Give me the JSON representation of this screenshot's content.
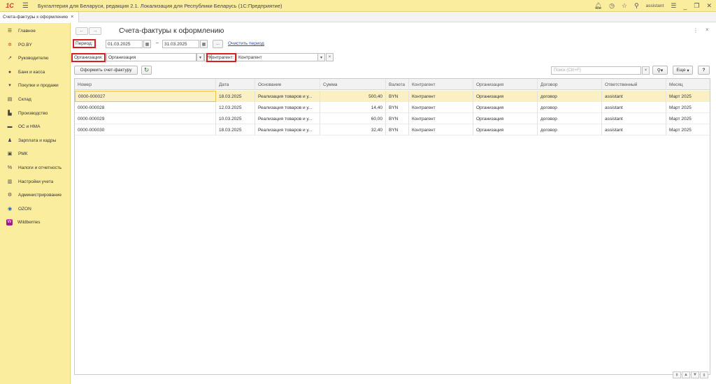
{
  "window": {
    "app_title": "Бухгалтерия для Беларуси, редакция 2.1. Локализация для Республики Беларусь  (1С:Предприятие)",
    "logo": "1С",
    "user": "assistant"
  },
  "tabs": [
    {
      "label": "Счета-фактуры к оформлению",
      "close": "×"
    }
  ],
  "sidebar": {
    "items": [
      {
        "label": "Главное",
        "icon": "menu-icon"
      },
      {
        "label": "PO.BY",
        "icon": "star-icon"
      },
      {
        "label": "Руководителю",
        "icon": "trend-icon"
      },
      {
        "label": "Банк и касса",
        "icon": "bank-icon"
      },
      {
        "label": "Покупки и продажи",
        "icon": "cart-icon"
      },
      {
        "label": "Склад",
        "icon": "warehouse-icon"
      },
      {
        "label": "Производство",
        "icon": "factory-icon"
      },
      {
        "label": "ОС и НМА",
        "icon": "truck-icon"
      },
      {
        "label": "Зарплата и кадры",
        "icon": "person-icon"
      },
      {
        "label": "РМК",
        "icon": "register-icon"
      },
      {
        "label": "Налоги и отчетность",
        "icon": "tax-icon"
      },
      {
        "label": "Настройки учета",
        "icon": "settings-doc-icon"
      },
      {
        "label": "Администрирование",
        "icon": "gear-icon"
      },
      {
        "label": "OZON",
        "icon": "ozon-icon"
      },
      {
        "label": "Wildberries",
        "icon": "wildberries-icon"
      }
    ]
  },
  "header": {
    "title": "Счета-фактуры к оформлению",
    "back": "←",
    "forward": "→",
    "more": "⋮",
    "close": "×"
  },
  "filters": {
    "period_label": "Период:",
    "date_from": "01.03.2025",
    "date_to": "31.03.2025",
    "dash": "–",
    "dots": "...",
    "clear_period": "Очистить период",
    "org_label": "Организация:",
    "org_value": "Организация",
    "counterparty_label": "Контрагент:",
    "counterparty_value": "Контрагент"
  },
  "actions": {
    "create_button": "Оформить счет-фактуру",
    "refresh": "↻",
    "search_placeholder": "Поиск (Ctrl+F)",
    "more_button": "Еще",
    "help_button": "?"
  },
  "table": {
    "columns": [
      "Номер",
      "Дата",
      "Основание",
      "Сумма",
      "Валюта",
      "Контрагент",
      "Организация",
      "Договор",
      "Ответственный",
      "Месяц"
    ],
    "rows": [
      [
        "0000-000027",
        "18.03.2025",
        "Реализация товаров и у...",
        "500,40",
        "BYN",
        "Контрагент",
        "Организация",
        "договор",
        "assistant",
        "Март 2025"
      ],
      [
        "0000-000028",
        "12.03.2025",
        "Реализация товаров и у...",
        "14,40",
        "BYN",
        "Контрагент",
        "Организация",
        "договор",
        "assistant",
        "Март 2025"
      ],
      [
        "0000-000029",
        "10.03.2025",
        "Реализация товаров и у...",
        "60,00",
        "BYN",
        "Контрагент",
        "Организация",
        "договор",
        "assistant",
        "Март 2025"
      ],
      [
        "0000-000030",
        "18.03.2025",
        "Реализация товаров и у...",
        "32,40",
        "BYN",
        "Контрагент",
        "Организация",
        "договор",
        "assistant",
        "Март 2025"
      ]
    ]
  },
  "pager": [
    "⇞",
    "▲",
    "▼",
    "⇟"
  ]
}
